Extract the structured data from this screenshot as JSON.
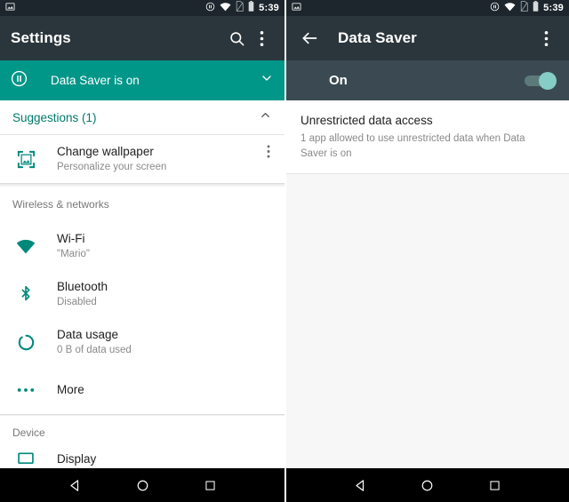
{
  "left": {
    "statusbar": {
      "notification_icon": "image-icon",
      "icons": [
        "data-saver-icon",
        "wifi-icon",
        "no-sim-icon",
        "battery-icon"
      ],
      "time": "5:39"
    },
    "toolbar": {
      "title": "Settings",
      "search_icon": "search-icon",
      "overflow_icon": "overflow-menu-icon"
    },
    "banner": {
      "icon": "data-saver-pause-icon",
      "text": "Data Saver is on",
      "chevron_icon": "chevron-down-icon",
      "color": "#009688"
    },
    "suggestions": {
      "title": "Suggestions (1)",
      "collapse_icon": "chevron-up-icon",
      "items": [
        {
          "icon": "wallpaper-icon",
          "title": "Change wallpaper",
          "subtitle": "Personalize your screen",
          "overflow_icon": "overflow-menu-icon"
        }
      ]
    },
    "sections": [
      {
        "header": "Wireless & networks",
        "items": [
          {
            "icon": "wifi-icon",
            "title": "Wi-Fi",
            "subtitle": "\"Mario\""
          },
          {
            "icon": "bluetooth-icon",
            "title": "Bluetooth",
            "subtitle": "Disabled"
          },
          {
            "icon": "data-usage-icon",
            "title": "Data usage",
            "subtitle": "0 B of data used"
          },
          {
            "icon": "more-dots-icon",
            "title": "More",
            "subtitle": ""
          }
        ]
      },
      {
        "header": "Device",
        "items": [
          {
            "icon": "display-icon",
            "title": "Display",
            "subtitle": ""
          }
        ]
      }
    ]
  },
  "right": {
    "statusbar": {
      "notification_icon": "image-icon",
      "icons": [
        "data-saver-icon",
        "wifi-icon",
        "no-sim-icon",
        "battery-icon"
      ],
      "time": "5:39"
    },
    "toolbar": {
      "back_icon": "back-arrow-icon",
      "title": "Data Saver",
      "overflow_icon": "overflow-menu-icon"
    },
    "toggle": {
      "label": "On",
      "state": "on",
      "thumb_color": "#85cdc6",
      "track_color": "#5d7a7a"
    },
    "preferences": [
      {
        "title": "Unrestricted data access",
        "subtitle": "1 app allowed to use unrestricted data when Data Saver is on"
      }
    ]
  },
  "navbar": {
    "back_label": "back-button",
    "home_label": "home-button",
    "recents_label": "recents-button"
  },
  "colors": {
    "accent": "#009688",
    "toolbar": "#2b363c",
    "statusbar": "#1c262c",
    "toggle_row": "#3b4a52"
  }
}
